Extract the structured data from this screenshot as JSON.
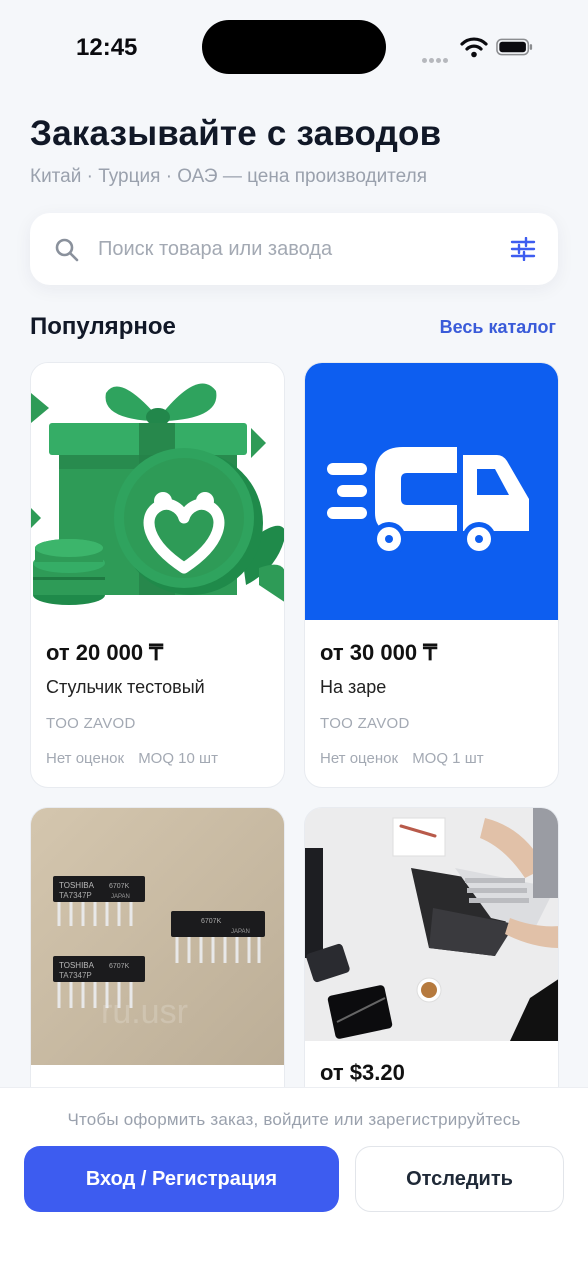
{
  "status_bar": {
    "time": "12:45"
  },
  "header": {
    "title": "Заказывайте с заводов",
    "subtitle": "Китай · Турция · ОАЭ — цена производителя"
  },
  "search": {
    "placeholder": "Поиск товара или завода",
    "value": ""
  },
  "popular": {
    "title": "Популярное",
    "link": "Весь каталог"
  },
  "products": [
    {
      "price": "от 20 000 ₸",
      "name": "Стульчик тестовый",
      "seller": "TOO ZAVOD",
      "rating": "Нет оценок",
      "moq": "MOQ 10 шт"
    },
    {
      "price": "от 30 000 ₸",
      "name": "На заре",
      "seller": "TOO ZAVOD",
      "rating": "Нет оценок",
      "moq": "MOQ 1 шт"
    },
    {
      "price": "",
      "name": "",
      "seller": "",
      "rating": "",
      "moq": ""
    },
    {
      "price": "от $3.20",
      "name": "",
      "seller": "",
      "rating": "",
      "moq": ""
    }
  ],
  "chip_labels": {
    "brand": "TOSHIBA",
    "part": "TA7347P",
    "code": "6707K",
    "origin": "JAPAN",
    "watermark": "ru.usr"
  },
  "bottom_bar": {
    "hint": "Чтобы оформить заказ, войдите или зарегистрируйтесь",
    "primary": "Вход / Регистрация",
    "secondary": "Отследить"
  },
  "colors": {
    "accent": "#3d5cf0",
    "link": "#3a5bd9",
    "truck_bg": "#0d5ef0",
    "gift_green": "#2e9b57"
  },
  "icons": [
    "search-icon",
    "filter-icon",
    "wifi-icon",
    "battery-icon",
    "signal-icon"
  ]
}
